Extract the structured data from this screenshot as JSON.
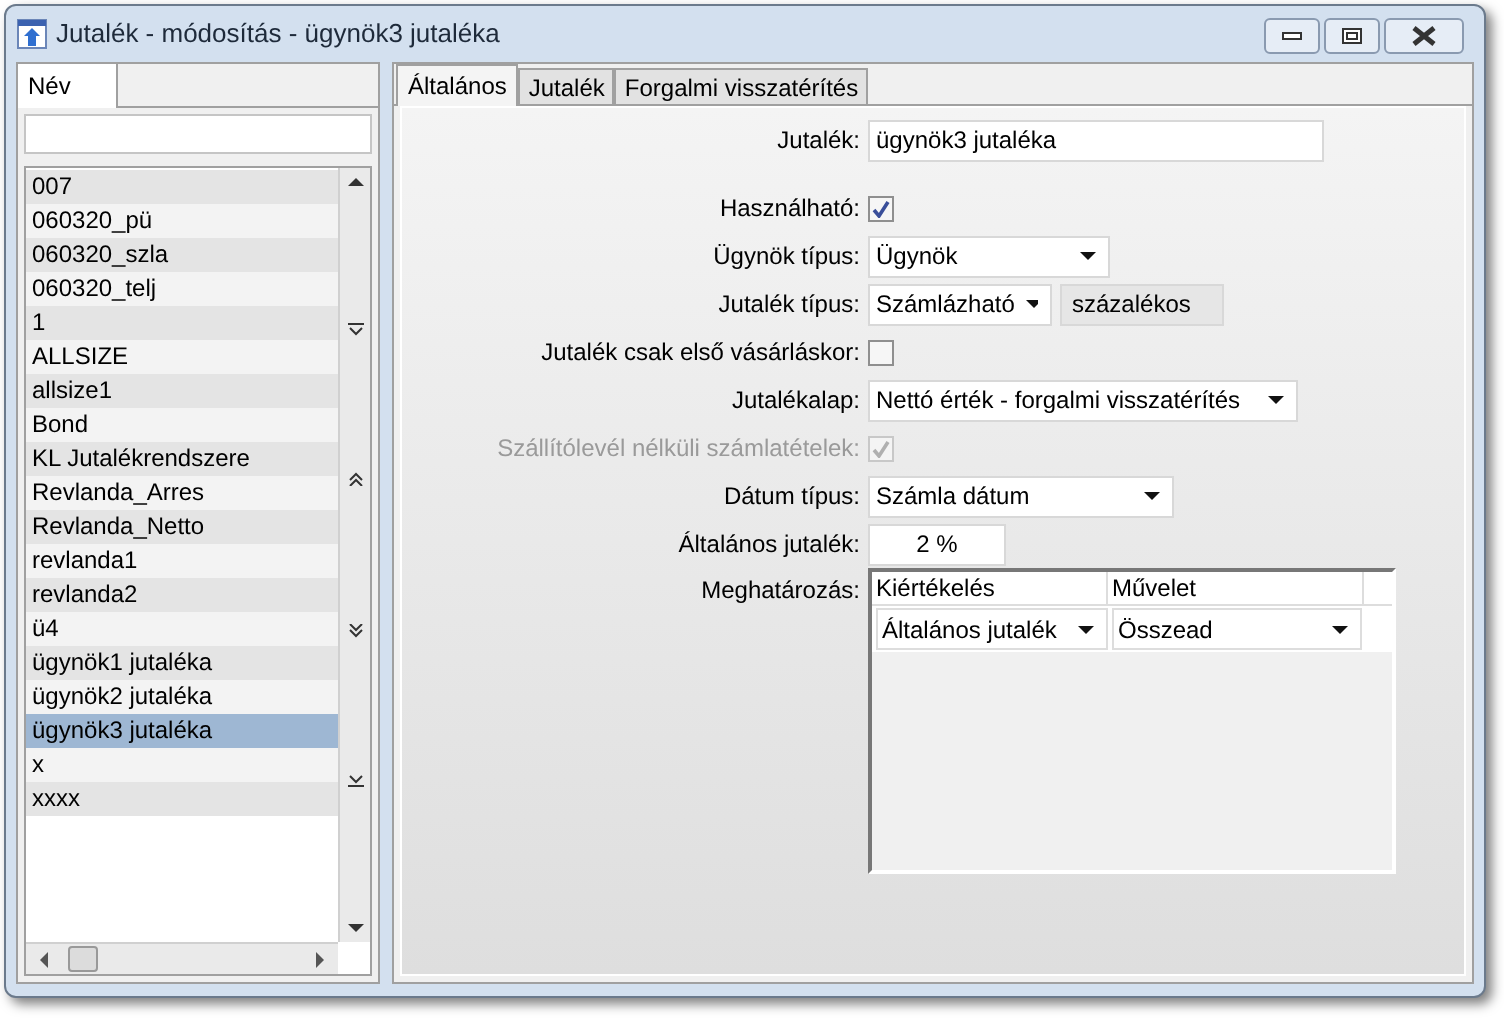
{
  "window": {
    "title": "Jutalék - módosítás - ügynök3 jutaléka"
  },
  "left_panel": {
    "tabs": [
      {
        "label": "Név",
        "selected": true
      }
    ],
    "items": [
      {
        "label": "007",
        "selected": false
      },
      {
        "label": "060320_pü",
        "selected": false
      },
      {
        "label": "060320_szla",
        "selected": false
      },
      {
        "label": "060320_telj",
        "selected": false
      },
      {
        "label": "1",
        "selected": false
      },
      {
        "label": "ALLSIZE",
        "selected": false
      },
      {
        "label": "allsize1",
        "selected": false
      },
      {
        "label": "Bond",
        "selected": false
      },
      {
        "label": "KL Jutalékrendszere",
        "selected": false
      },
      {
        "label": "Revlanda_Arres",
        "selected": false
      },
      {
        "label": "Revlanda_Netto",
        "selected": false
      },
      {
        "label": "revlanda1",
        "selected": false
      },
      {
        "label": "revlanda2",
        "selected": false
      },
      {
        "label": "ü4",
        "selected": false
      },
      {
        "label": "ügynök1 jutaléka",
        "selected": false
      },
      {
        "label": "ügynök2 jutaléka",
        "selected": false
      },
      {
        "label": "ügynök3 jutaléka",
        "selected": true
      },
      {
        "label": "x",
        "selected": false
      },
      {
        "label": "xxxx",
        "selected": false
      }
    ]
  },
  "tabs": [
    {
      "label": "Általános",
      "selected": true
    },
    {
      "label": "Jutalék",
      "selected": false
    },
    {
      "label": "Forgalmi visszatérítés",
      "selected": false
    }
  ],
  "fields": [
    {
      "kind": "text",
      "label": "Jutalék:",
      "value": "ügynök3 jutaléka"
    },
    {
      "kind": "checkbox",
      "label": "Használható:",
      "checked": true,
      "disabled": false
    },
    {
      "kind": "select",
      "label": "Ügynök típus:",
      "value": "Ügynök"
    },
    {
      "kind": "select_extra",
      "label": "Jutalék típus:",
      "value": "Számlázható",
      "extra": "százalékos"
    },
    {
      "kind": "checkbox",
      "label": "Jutalék csak első vásárláskor:",
      "checked": false,
      "disabled": false
    },
    {
      "kind": "select",
      "label": "Jutalékalap:",
      "value": "Nettó érték - forgalmi visszatérítés"
    },
    {
      "kind": "checkbox",
      "label": "Szállítólevél nélküli számlatételek:",
      "checked": true,
      "disabled": true
    },
    {
      "kind": "select",
      "label": "Dátum típus:",
      "value": "Számla dátum"
    },
    {
      "kind": "number",
      "label": "Általános jutalék:",
      "value": "2 %"
    },
    {
      "kind": "grid",
      "label": "Meghatározás:",
      "columns": [
        "Kiértékelés",
        "Művelet"
      ],
      "rows": [
        [
          "Általános jutalék",
          "Összead"
        ]
      ]
    }
  ]
}
